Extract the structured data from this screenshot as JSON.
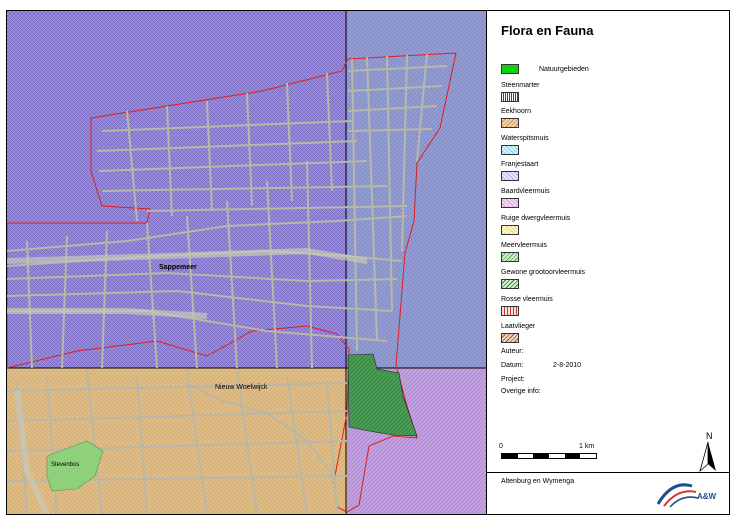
{
  "panel": {
    "title": "Flora en Fauna",
    "legend": [
      {
        "label": "Natuurgebieden",
        "swatch": "natuur"
      },
      {
        "label": "Steenmarter",
        "swatch": "steenmarter"
      },
      {
        "label": "Eekhoorn",
        "swatch": "eekhoorn"
      },
      {
        "label": "Waterspitsmuis",
        "swatch": "waterspitsmuis"
      },
      {
        "label": "Franjestaart",
        "swatch": "franjestaart"
      },
      {
        "label": "Baardvleermuis",
        "swatch": "baardvleermuis"
      },
      {
        "label": "Ruige dwergvleermuis",
        "swatch": "ruige"
      },
      {
        "label": "Meervleermuis",
        "swatch": "meervleermuis"
      },
      {
        "label": "Gewone grootoorvleermuis",
        "swatch": "grootoor"
      },
      {
        "label": "Rosse vleermuis",
        "swatch": "rosse"
      },
      {
        "label": "Laatvlieger",
        "swatch": "laatvlieger"
      }
    ],
    "meta": {
      "auteur_label": "Auteur:",
      "auteur_value": "",
      "datum_label": "Datum:",
      "datum_value": "2-8-2010",
      "project_label": "Project:",
      "overige_label": "Overige info:"
    },
    "scalebar": {
      "start": "0",
      "end": "1 km"
    },
    "north": "N",
    "company": "Altenburg en Wymenga",
    "logo_text": "A&W"
  },
  "map": {
    "labels": {
      "town": "Sappemeer",
      "place": "Nieuw Woelwijck",
      "park": "Stevenbos"
    }
  },
  "colors": {
    "purple_bg": "#8c7fd1",
    "blue_bg": "#8891c8",
    "orange_bg": "#d7b27a",
    "violet_bg": "#b593d4",
    "study_border": "#e01d1d",
    "roads": "#b9b7a7",
    "green": "#3d8f4a",
    "lightgreen": "#8fd07a"
  }
}
